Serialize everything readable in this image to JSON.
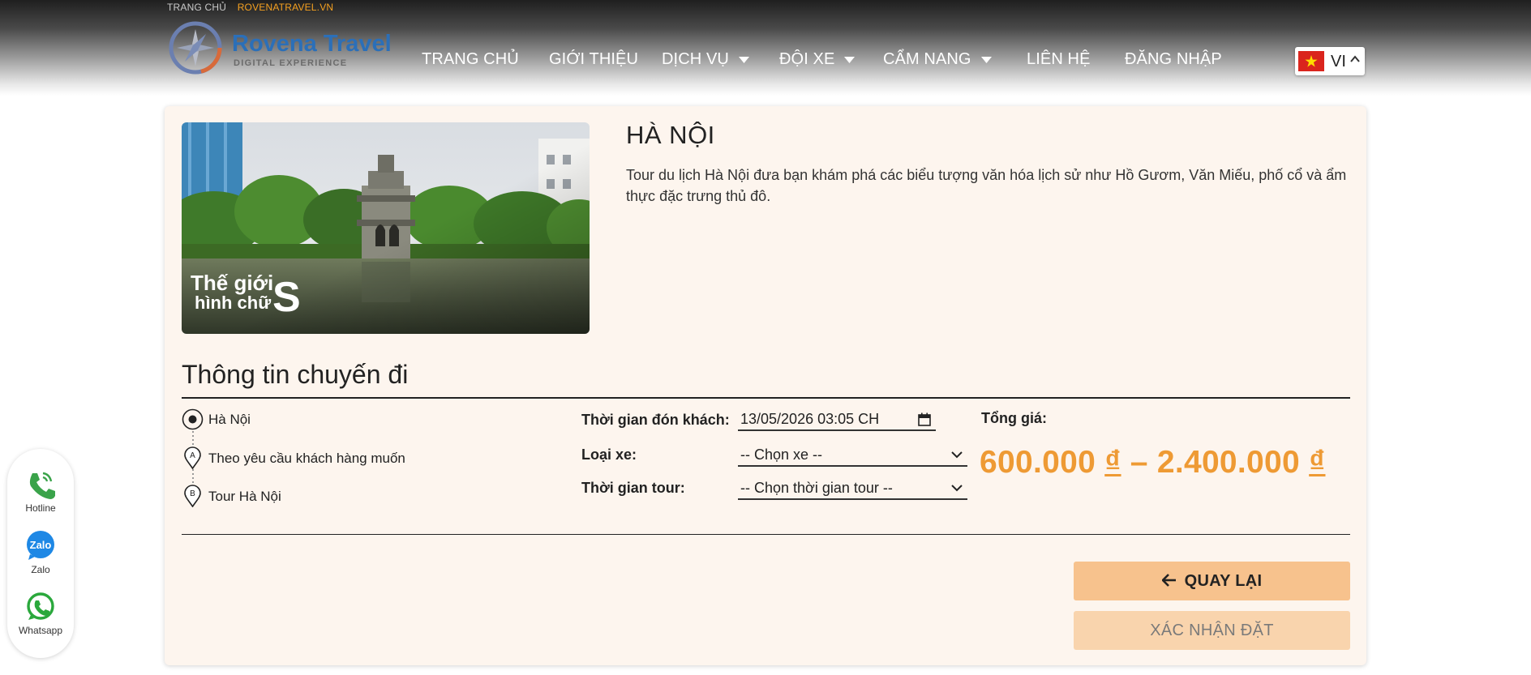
{
  "breadcrumb": {
    "home": "TRANG CHỦ",
    "site": "ROVENATRAVEL.VN"
  },
  "logo": {
    "title": "Rovena Travel",
    "subtitle": "DIGITAL EXPERIENCE",
    "icon": "compass-icon"
  },
  "nav": {
    "items": [
      {
        "label": "TRANG CHỦ",
        "dropdown": false
      },
      {
        "label": "GIỚI THIỆU",
        "dropdown": false
      },
      {
        "label": "DỊCH VỤ",
        "dropdown": true
      },
      {
        "label": "ĐỘI XE",
        "dropdown": true
      },
      {
        "label": "CẨM NANG",
        "dropdown": true
      },
      {
        "label": "LIÊN HỆ",
        "dropdown": false
      },
      {
        "label": "ĐĂNG NHẬP",
        "dropdown": false
      }
    ]
  },
  "language": {
    "code": "VI",
    "flag": "vietnam-flag-icon"
  },
  "destination": {
    "title": "HÀ NỘI",
    "description": "Tour du lịch Hà Nội đưa bạn khám phá các biểu tượng văn hóa lịch sử như Hồ Gươm, Văn Miếu, phố cổ và ẩm thực đặc trưng thủ đô.",
    "image_caption_line1": "Thế giới",
    "image_caption_line2": "hình chữ",
    "image_caption_letter": "S"
  },
  "trip": {
    "section_title": "Thông tin chuyến đi",
    "stops": [
      {
        "icon": "origin-dot-icon",
        "label": "Hà Nội"
      },
      {
        "icon": "pin-a-icon",
        "label": "Theo yêu cầu khách hàng muốn"
      },
      {
        "icon": "pin-b-icon",
        "label": "Tour Hà Nội"
      }
    ],
    "pickup_label": "Thời gian đón khách:",
    "pickup_value": "13/05/2026 03:05 CH",
    "vehicle_label": "Loại xe:",
    "vehicle_value": "-- Chọn xe --",
    "duration_label": "Thời gian tour:",
    "duration_value": "-- Chọn thời gian tour --",
    "total_label": "Tổng giá:",
    "price_min": "600.000",
    "price_max": "2.400.000",
    "currency": "₫",
    "price_separator": "–"
  },
  "actions": {
    "back_label": "QUAY LẠI",
    "confirm_label": "XÁC NHẬN ĐẶT"
  },
  "contact": {
    "items": [
      {
        "label": "Hotline",
        "icon": "phone-icon",
        "color": "#3aa34a"
      },
      {
        "label": "Zalo",
        "icon": "zalo-icon",
        "color": "#1e88e5"
      },
      {
        "label": "Whatsapp",
        "icon": "whatsapp-icon",
        "color": "#2aa83c"
      }
    ]
  },
  "colors": {
    "accent": "#ee9a34",
    "card_bg": "#fdf5ee",
    "brand_blue": "#2b6fb8",
    "breadcrumb_site": "#f4a020"
  }
}
